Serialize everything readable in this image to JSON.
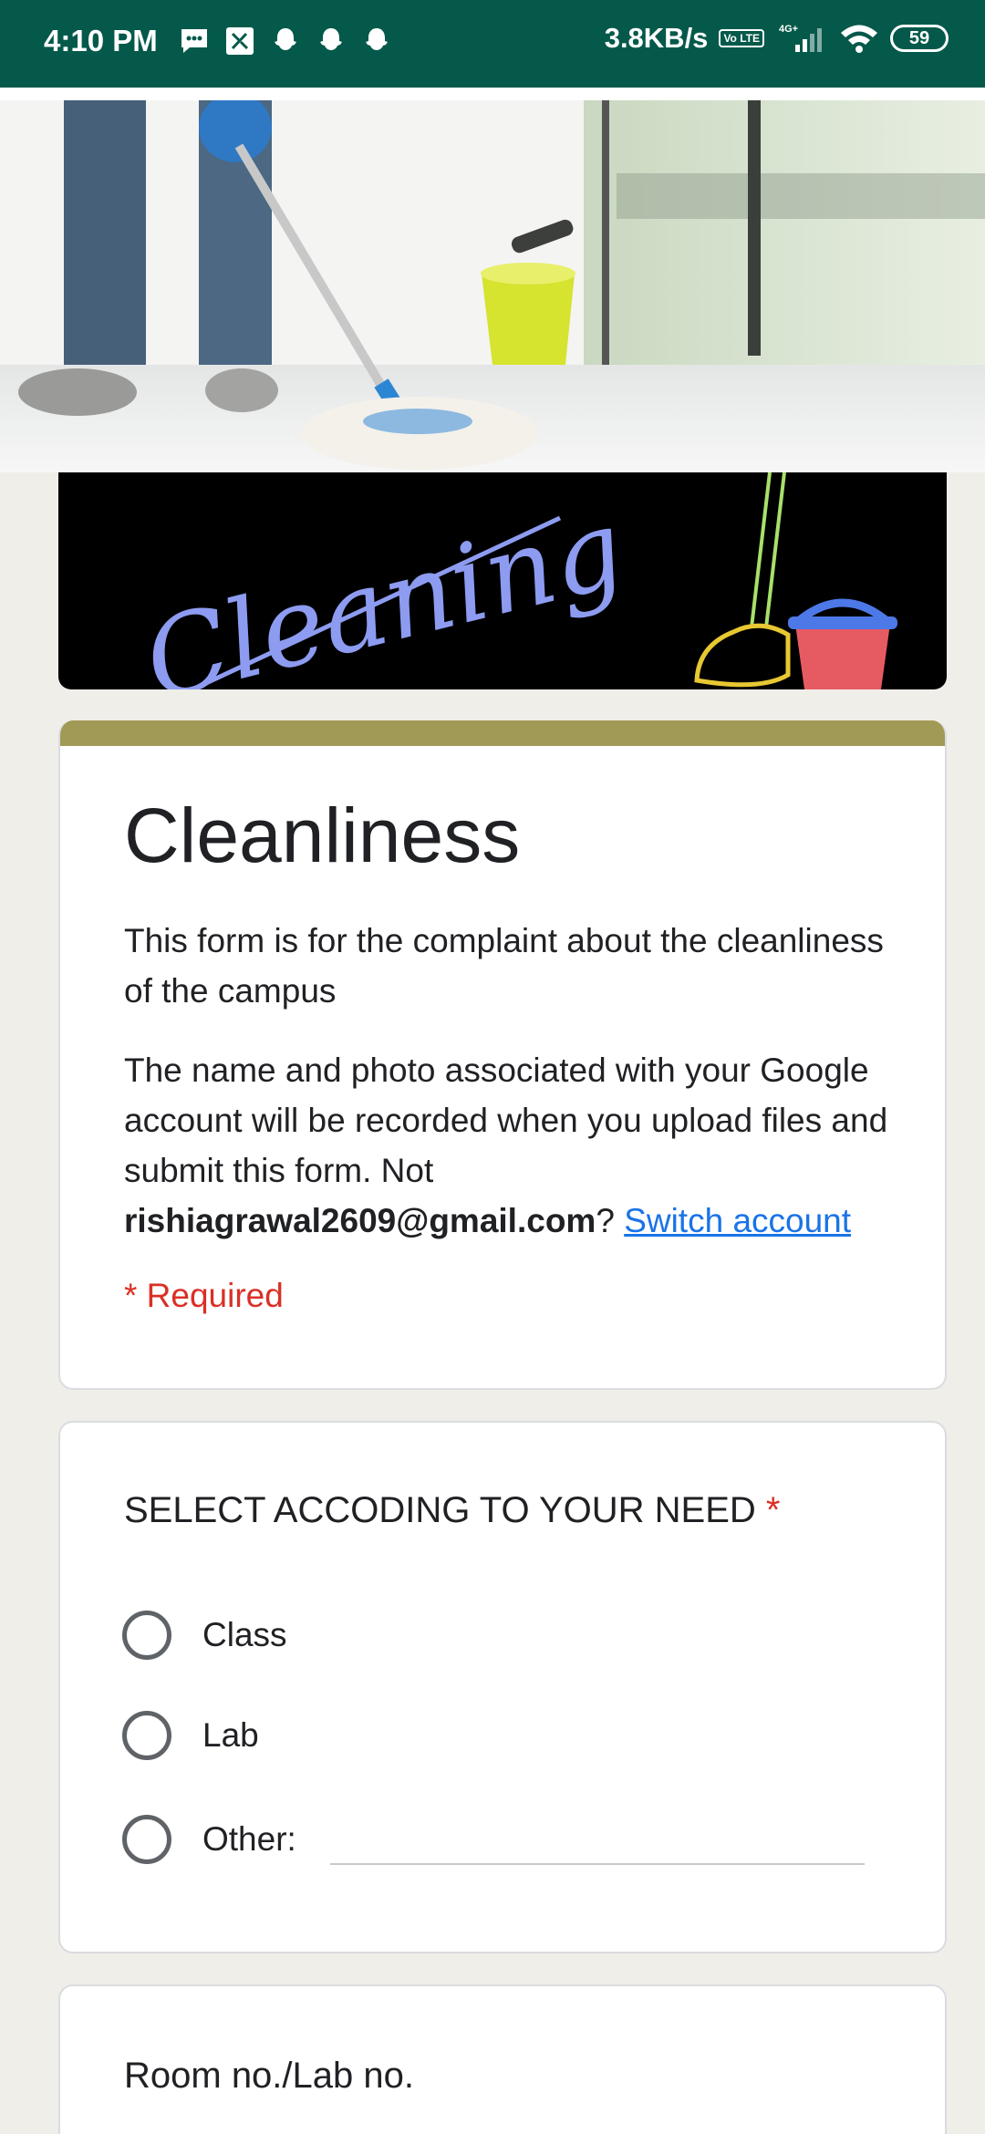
{
  "status_bar": {
    "time": "4:10 PM",
    "net_speed": "3.8KB/s",
    "volte": "Vo LTE",
    "network": "4G+",
    "battery": "59",
    "icons": [
      "messages-icon",
      "nfc-icon",
      "snapchat-icon",
      "snapchat-icon",
      "snapchat-icon",
      "volte-icon",
      "signal-icon",
      "wifi-icon",
      "battery-icon"
    ]
  },
  "banner": {
    "text": "Cleaning"
  },
  "form": {
    "title": "Cleanliness",
    "description": "This form is for the complaint about the cleanliness of the campus",
    "notice_prefix": "The name and photo associated with your Google account will be recorded when you upload files and submit this form. Not ",
    "email": "rishiagrawal2609@gmail.com",
    "notice_suffix": "? ",
    "switch_account": "Switch account",
    "required_note": "* Required",
    "accent_color": "#a19a56"
  },
  "question1": {
    "title": "SELECT ACCODING TO YOUR NEED",
    "required_star": "*",
    "options": [
      "Class",
      "Lab",
      "Other:"
    ]
  },
  "question2": {
    "title": "Room no./Lab no."
  },
  "colors": {
    "status_bar": "#04594a",
    "page_bg": "#efeee8",
    "required": "#d93025",
    "link": "#1a73e8"
  }
}
